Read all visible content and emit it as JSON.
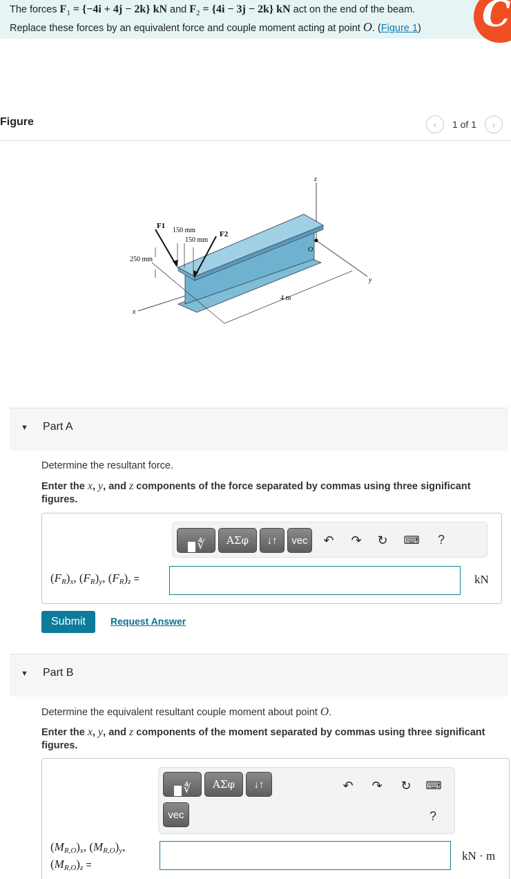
{
  "problem": {
    "text_1": "The forces ",
    "f1_symbol": "F",
    "f1_sub": "1",
    "f1_value": " = {−4i + 4j − 2k} kN",
    "text_2": " and ",
    "f2_symbol": "F",
    "f2_sub": "2",
    "f2_value": " = {4i − 3j − 2k} kN",
    "text_3": " act on the end of the beam.",
    "text_4": "Replace these forces by an equivalent force and couple moment acting at point ",
    "point": "O",
    "text_5": ". (",
    "figure_link": "Figure 1",
    "text_6": ")"
  },
  "logo": {
    "glyph": "C",
    "color": "#f04e23"
  },
  "figure": {
    "title": "Figure",
    "pager_text": "1 of 1",
    "prev_icon": "‹",
    "next_icon": "›",
    "labels": {
      "f1": "F1",
      "f2": "F2",
      "dim1": "150 mm",
      "dim2": "150 mm",
      "dim3": "250 mm",
      "length": "4 m",
      "axis_x": "x",
      "axis_y": "y",
      "axis_z": "z",
      "origin": "O"
    },
    "beam_color": "#8ec6dc"
  },
  "partA": {
    "label": "Part A",
    "prompt": "Determine the resultant force.",
    "instruction_1": "Enter the ",
    "var_x": "x",
    "sep1": ", ",
    "var_y": "y",
    "sep2": ", and ",
    "var_z": "z",
    "instruction_2": " components of the force separated by commas using three significant figures.",
    "toolbar": {
      "symbols_label": "ΑΣφ",
      "arrows_label": "↓↑",
      "vec_label": "vec",
      "help_label": "?"
    },
    "answer_label": "(F_R)x, (F_R)y, (F_R)z =",
    "answer_value": "",
    "unit": "kN",
    "submit_label": "Submit",
    "request_label": "Request Answer"
  },
  "partB": {
    "label": "Part B",
    "prompt_1": "Determine the equivalent resultant couple moment about point ",
    "prompt_point": "O",
    "prompt_2": ".",
    "instruction_1": "Enter the ",
    "var_x": "x",
    "sep1": ", ",
    "var_y": "y",
    "sep2": ", and ",
    "var_z": "z",
    "instruction_2": " components of the moment separated by commas using three significant figures.",
    "toolbar": {
      "symbols_label": "ΑΣφ",
      "arrows_label": "↓↑",
      "vec_label": "vec",
      "help_label": "?"
    },
    "answer_value": "",
    "unit": "kN · m"
  }
}
